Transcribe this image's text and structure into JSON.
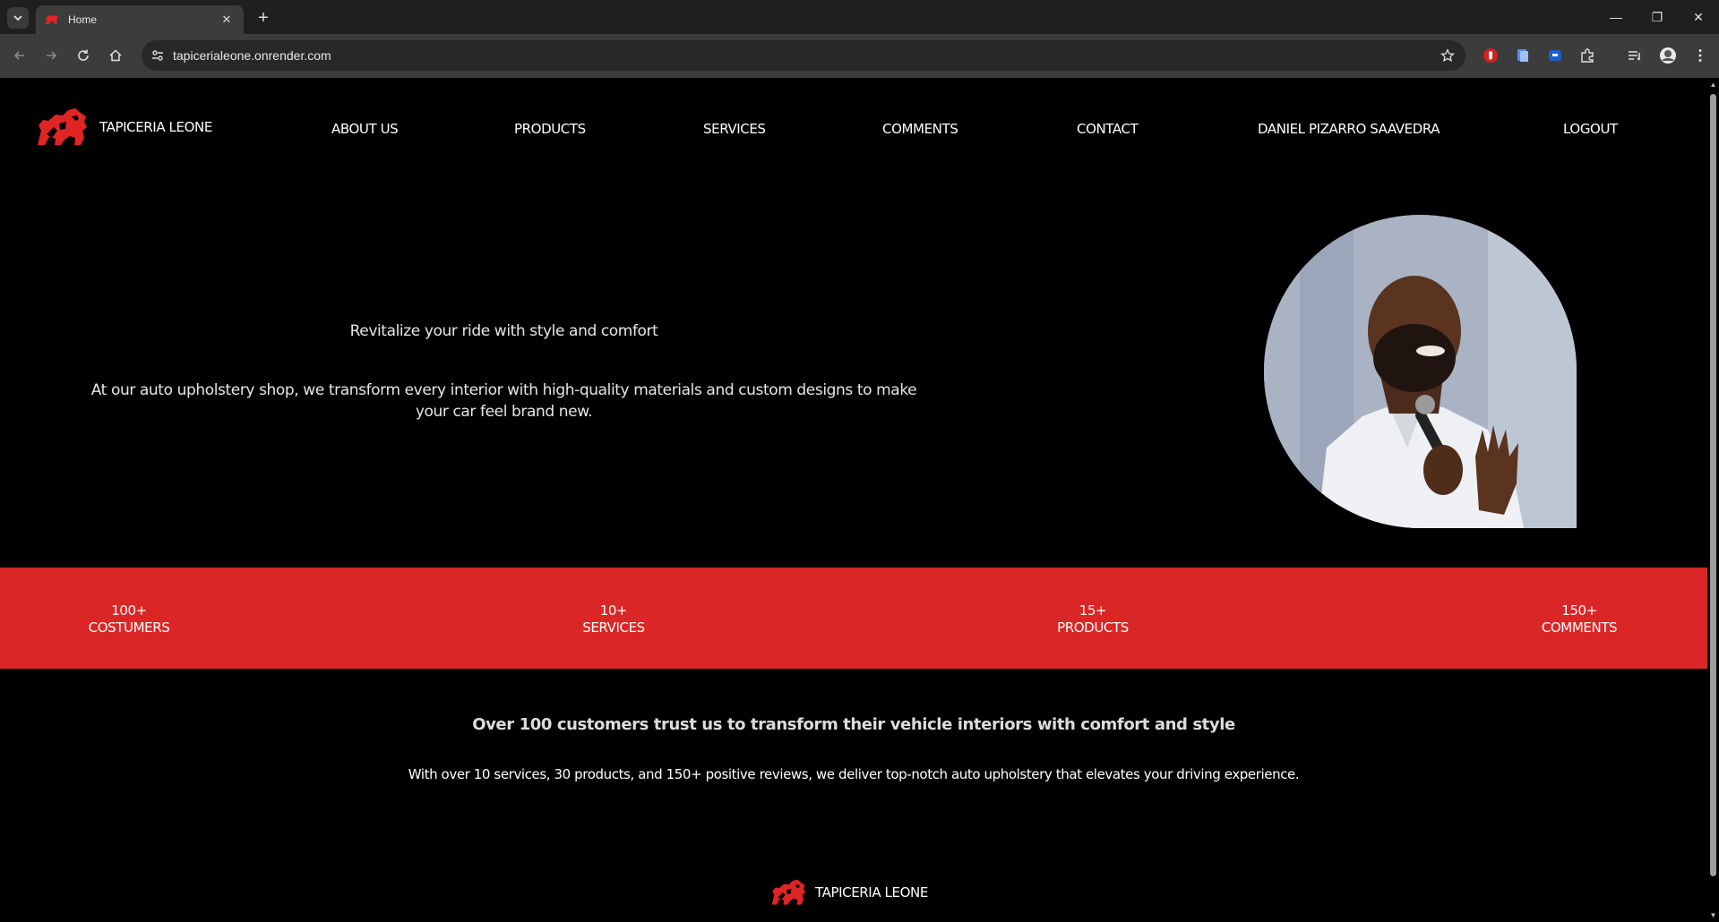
{
  "browser": {
    "tab_title": "Home",
    "url": "tapicerialeone.onrender.com",
    "close_tab_glyph": "✕",
    "new_tab_glyph": "+",
    "minimize_glyph": "—",
    "restore_glyph": "❐",
    "close_window_glyph": "✕",
    "icons": [
      "tab-list-icon",
      "back-icon",
      "forward-icon",
      "reload-icon",
      "home-icon",
      "site-info-icon",
      "bookmark-star-icon",
      "extension-red-icon",
      "extension-doc-icon",
      "extension-blue-icon",
      "extensions-puzzle-icon",
      "reading-list-icon",
      "profile-avatar-icon",
      "menu-kebab-icon"
    ]
  },
  "nav": {
    "brand": "TAPICERIA LEONE",
    "links": [
      {
        "label": "ABOUT US"
      },
      {
        "label": "PRODUCTS"
      },
      {
        "label": "SERVICES"
      },
      {
        "label": "COMMENTS"
      },
      {
        "label": "CONTACT"
      },
      {
        "label": "DANIEL PIZARRO SAAVEDRA"
      },
      {
        "label": "LOGOUT"
      }
    ]
  },
  "hero": {
    "tagline": "Revitalize your ride with style and comfort",
    "description": "At our auto upholstery shop, we transform every interior with high-quality materials and custom designs to make your car feel brand new."
  },
  "stats": [
    {
      "value": "100+",
      "label": "COSTUMERS"
    },
    {
      "value": "10+",
      "label": "SERVICES"
    },
    {
      "value": "15+",
      "label": "PRODUCTS"
    },
    {
      "value": "150+",
      "label": "COMMENTS"
    }
  ],
  "trust": {
    "title": "Over 100 customers trust us to transform their vehicle interiors with comfort and style",
    "description": "With over 10 services, 30 products, and 150+ positive reviews, we deliver top-notch auto upholstery that elevates your driving experience."
  },
  "footer": {
    "brand": "TAPICERIA LEONE"
  },
  "colors": {
    "accent_red": "#da2626",
    "page_bg": "#000000",
    "chrome_tabbar": "#1f1f1f",
    "chrome_toolbar": "#3c3c3c"
  }
}
